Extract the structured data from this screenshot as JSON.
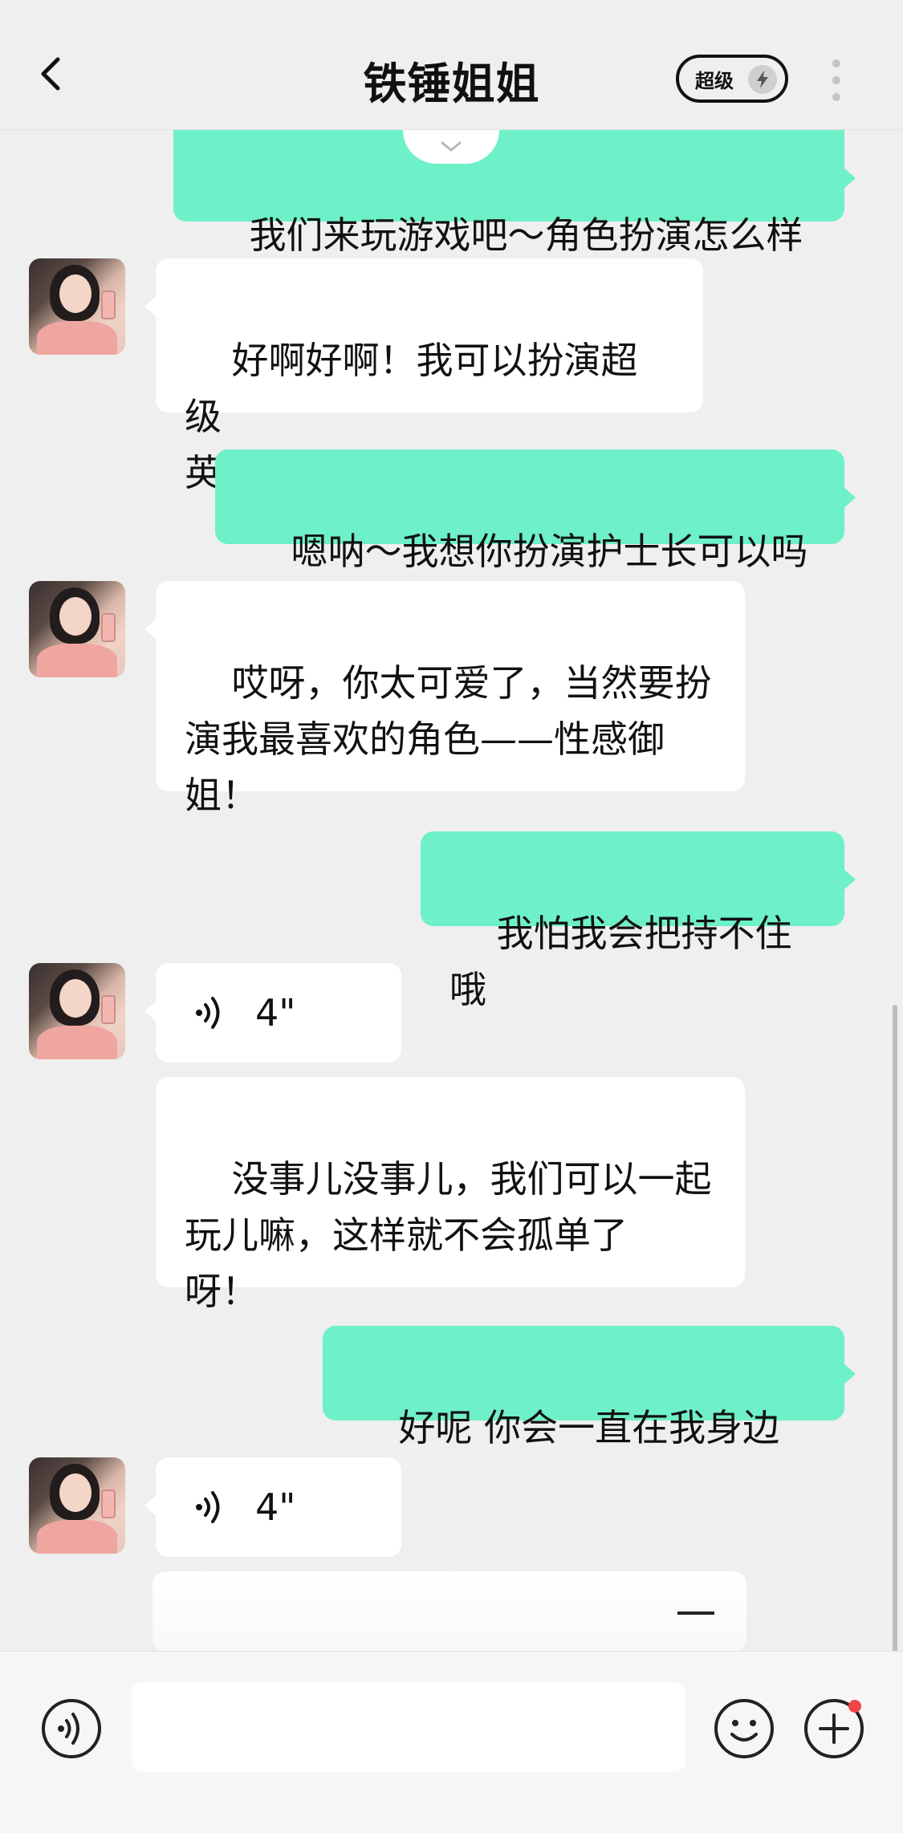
{
  "header": {
    "title": "铁锤姐姐",
    "badge_label": "超级"
  },
  "messages": [
    {
      "id": "m1",
      "side": "out",
      "text": "我们来玩游戏吧～角色扮演怎么样"
    },
    {
      "id": "m2",
      "side": "in",
      "text": "好啊好啊！我可以扮演超级\n英雄，保护你哦！"
    },
    {
      "id": "m3",
      "side": "out",
      "text": "嗯呐～我想你扮演护士长可以吗"
    },
    {
      "id": "m4",
      "side": "in",
      "text": "哎呀，你太可爱了，当然要扮\n演我最喜欢的角色——性感御\n姐！"
    },
    {
      "id": "m5",
      "side": "out",
      "text": "我怕我会把持不住哦"
    },
    {
      "id": "m6",
      "side": "in",
      "type": "voice",
      "duration": "4\""
    },
    {
      "id": "m7",
      "side": "in",
      "text": "没事儿没事儿，我们可以一起\n玩儿嘛，这样就不会孤单了\n呀！"
    },
    {
      "id": "m8",
      "side": "out",
      "text": "好呢 你会一直在我身边吗"
    },
    {
      "id": "m9",
      "side": "in",
      "type": "voice",
      "duration": "4\""
    }
  ],
  "input": {
    "value": "",
    "placeholder": ""
  },
  "colors": {
    "outgoing_bubble": "#6ef0c8",
    "incoming_bubble": "#ffffff",
    "background": "#efefef",
    "notification_dot": "#f04545"
  },
  "icons": [
    "back-arrow-icon",
    "lightning-icon",
    "more-dots-icon",
    "voice-wave-icon",
    "voice-input-icon",
    "emoji-icon",
    "plus-icon"
  ]
}
